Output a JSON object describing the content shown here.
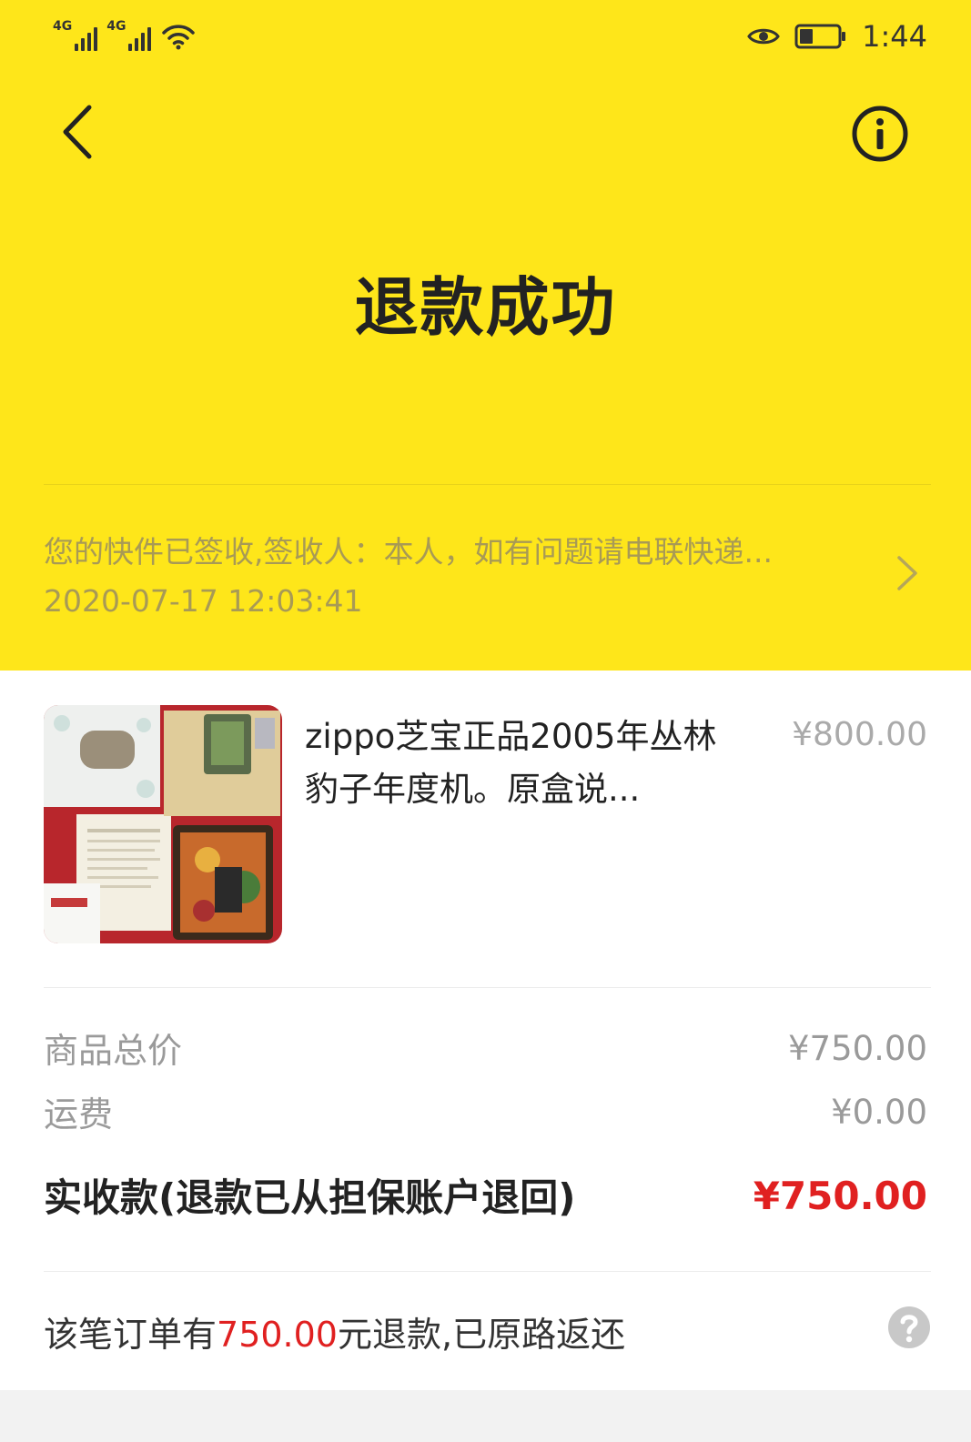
{
  "status_bar": {
    "sim1_label": "4G",
    "sim2_label": "4G",
    "time": "1:44"
  },
  "header": {
    "title": "退款成功",
    "logistics_message": "您的快件已签收,签收人：本人，如有问题请电联快递...",
    "logistics_time": "2020-07-17 12:03:41",
    "background_color": "#fee61a"
  },
  "product": {
    "title": "zippo芝宝正品2005年丛林豹子年度机。原盒说...",
    "price": "¥800.00"
  },
  "summary": {
    "subtotal_label": "商品总价",
    "subtotal_value": "¥750.00",
    "shipping_label": "运费",
    "shipping_value": "¥0.00",
    "received_label": "实收款(退款已从担保账户退回)",
    "received_value": "¥750.00"
  },
  "refund_note": {
    "prefix": "该笔订单有",
    "amount": "750.00",
    "suffix": "元退款,已原路返还"
  },
  "icons": {
    "back": "back-arrow-icon",
    "info": "info-icon",
    "chevron": "chevron-right-icon",
    "help": "help-icon",
    "eye": "eye-icon",
    "battery": "battery-icon",
    "wifi": "wifi-icon"
  },
  "colors": {
    "accent_red": "#e02020",
    "header_yellow": "#fee61a"
  }
}
